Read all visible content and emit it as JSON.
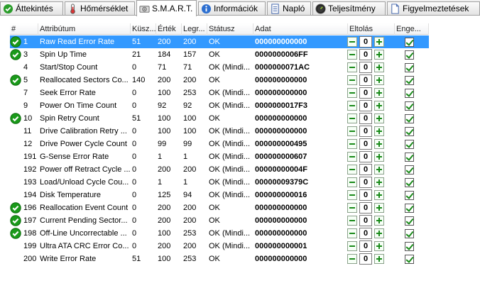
{
  "tabs": [
    {
      "label": "Áttekintés",
      "icon": "checkmark-icon",
      "active": false
    },
    {
      "label": "Hőmérséklet",
      "icon": "thermometer-icon",
      "active": false
    },
    {
      "label": "S.M.A.R.T.",
      "icon": "smart-disk-icon",
      "active": true
    },
    {
      "label": "Információk",
      "icon": "info-icon",
      "active": false
    },
    {
      "label": "Napló",
      "icon": "log-icon",
      "active": false
    },
    {
      "label": "Teljesítmény",
      "icon": "gauge-icon",
      "active": false
    },
    {
      "label": "Figyelmeztetések",
      "icon": "warning-doc-icon",
      "active": false
    }
  ],
  "columns": [
    "#",
    "Attribútum",
    "Küsz...",
    "Érték",
    "Legr...",
    "Státusz",
    "Adat",
    "Eltolás",
    "Enge..."
  ],
  "rows": [
    {
      "id": "1",
      "attr": "Raw Read Error Rate",
      "thr": "51",
      "val": "200",
      "worst": "200",
      "status": "OK",
      "data": "000000000000",
      "offset": "0",
      "ok_icon": true,
      "selected": true
    },
    {
      "id": "3",
      "attr": "Spin Up Time",
      "thr": "21",
      "val": "184",
      "worst": "157",
      "status": "OK",
      "data": "0000000006FF",
      "offset": "0",
      "ok_icon": true,
      "selected": false
    },
    {
      "id": "4",
      "attr": "Start/Stop Count",
      "thr": "0",
      "val": "71",
      "worst": "71",
      "status": "OK (Mindi...",
      "data": "0000000071AC",
      "offset": "0",
      "ok_icon": false,
      "selected": false
    },
    {
      "id": "5",
      "attr": "Reallocated Sectors Co...",
      "thr": "140",
      "val": "200",
      "worst": "200",
      "status": "OK",
      "data": "000000000000",
      "offset": "0",
      "ok_icon": true,
      "selected": false
    },
    {
      "id": "7",
      "attr": "Seek Error Rate",
      "thr": "0",
      "val": "100",
      "worst": "253",
      "status": "OK (Mindi...",
      "data": "000000000000",
      "offset": "0",
      "ok_icon": false,
      "selected": false
    },
    {
      "id": "9",
      "attr": "Power On Time Count",
      "thr": "0",
      "val": "92",
      "worst": "92",
      "status": "OK (Mindi...",
      "data": "0000000017F3",
      "offset": "0",
      "ok_icon": false,
      "selected": false
    },
    {
      "id": "10",
      "attr": "Spin Retry Count",
      "thr": "51",
      "val": "100",
      "worst": "100",
      "status": "OK",
      "data": "000000000000",
      "offset": "0",
      "ok_icon": true,
      "selected": false
    },
    {
      "id": "11",
      "attr": "Drive Calibration Retry ...",
      "thr": "0",
      "val": "100",
      "worst": "100",
      "status": "OK (Mindi...",
      "data": "000000000000",
      "offset": "0",
      "ok_icon": false,
      "selected": false
    },
    {
      "id": "12",
      "attr": "Drive Power Cycle Count",
      "thr": "0",
      "val": "99",
      "worst": "99",
      "status": "OK (Mindi...",
      "data": "000000000495",
      "offset": "0",
      "ok_icon": false,
      "selected": false
    },
    {
      "id": "191",
      "attr": "G-Sense Error Rate",
      "thr": "0",
      "val": "1",
      "worst": "1",
      "status": "OK (Mindi...",
      "data": "000000000607",
      "offset": "0",
      "ok_icon": false,
      "selected": false
    },
    {
      "id": "192",
      "attr": "Power off Retract Cycle ...",
      "thr": "0",
      "val": "200",
      "worst": "200",
      "status": "OK (Mindi...",
      "data": "00000000004F",
      "offset": "0",
      "ok_icon": false,
      "selected": false
    },
    {
      "id": "193",
      "attr": "Load/Unload Cycle Cou...",
      "thr": "0",
      "val": "1",
      "worst": "1",
      "status": "OK (Mindi...",
      "data": "00000009379C",
      "offset": "0",
      "ok_icon": false,
      "selected": false
    },
    {
      "id": "194",
      "attr": "Disk Temperature",
      "thr": "0",
      "val": "125",
      "worst": "94",
      "status": "OK (Mindi...",
      "data": "000000000016",
      "offset": "0",
      "ok_icon": false,
      "selected": false
    },
    {
      "id": "196",
      "attr": "Reallocation Event Count",
      "thr": "0",
      "val": "200",
      "worst": "200",
      "status": "OK",
      "data": "000000000000",
      "offset": "0",
      "ok_icon": true,
      "selected": false
    },
    {
      "id": "197",
      "attr": "Current Pending Sector...",
      "thr": "0",
      "val": "200",
      "worst": "200",
      "status": "OK",
      "data": "000000000000",
      "offset": "0",
      "ok_icon": true,
      "selected": false
    },
    {
      "id": "198",
      "attr": "Off-Line Uncorrectable ...",
      "thr": "0",
      "val": "100",
      "worst": "253",
      "status": "OK (Mindi...",
      "data": "000000000000",
      "offset": "0",
      "ok_icon": true,
      "selected": false
    },
    {
      "id": "199",
      "attr": "Ultra ATA CRC Error Co...",
      "thr": "0",
      "val": "200",
      "worst": "200",
      "status": "OK (Mindi...",
      "data": "000000000001",
      "offset": "0",
      "ok_icon": false,
      "selected": false
    },
    {
      "id": "200",
      "attr": "Write Error Rate",
      "thr": "51",
      "val": "100",
      "worst": "253",
      "status": "OK",
      "data": "000000000000",
      "offset": "0",
      "ok_icon": false,
      "selected": false
    }
  ],
  "colors": {
    "selection": "#3399ff",
    "ok_green": "#1a9a1a",
    "step_green": "#1a8a1a"
  }
}
